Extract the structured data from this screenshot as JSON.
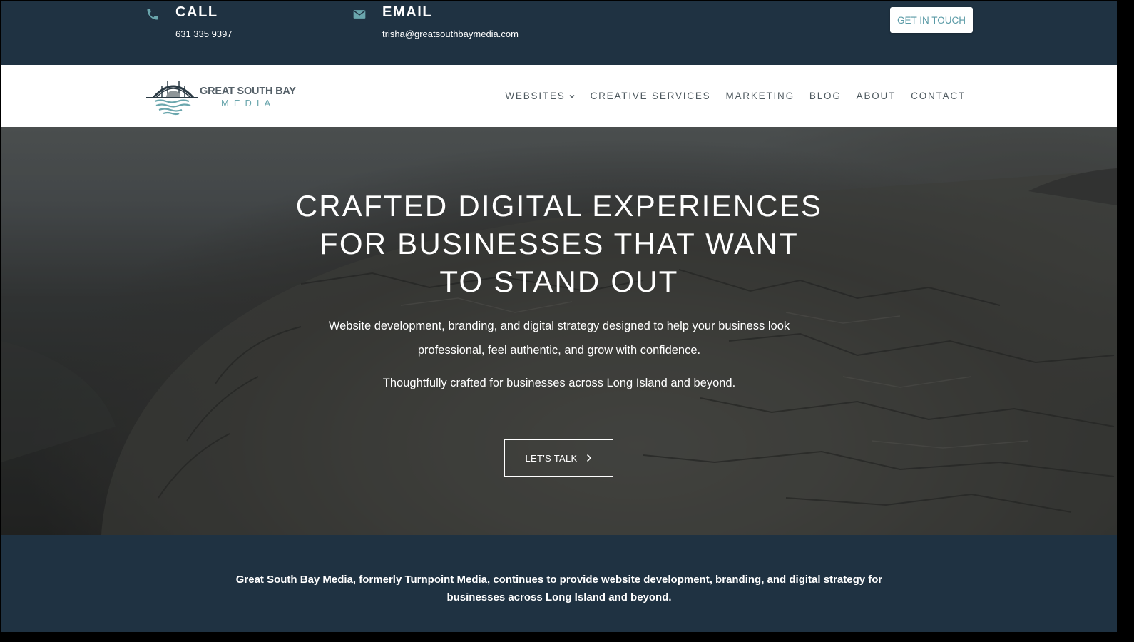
{
  "topbar": {
    "call": {
      "icon": "phone-icon",
      "title": "CALL",
      "value": "631 335 9397"
    },
    "email": {
      "icon": "envelope-icon",
      "title": "EMAIL",
      "value": "trisha@greatsouthbaymedia.com"
    },
    "cta_label": "GET IN TOUCH"
  },
  "logo": {
    "line1": "GREAT SOUTH BAY",
    "line2": "MEDIA"
  },
  "nav": {
    "items": [
      {
        "label": "WEBSITES",
        "has_dropdown": true
      },
      {
        "label": "CREATIVE SERVICES"
      },
      {
        "label": "MARKETING"
      },
      {
        "label": "BLOG"
      },
      {
        "label": "ABOUT"
      },
      {
        "label": "CONTACT"
      }
    ]
  },
  "hero": {
    "title_lines": [
      "CRAFTED DIGITAL EXPERIENCES",
      "FOR BUSINESSES THAT WANT",
      "TO STAND OUT"
    ],
    "subtitle": "Website development, branding, and digital strategy designed to help your business look professional, feel authentic, and grow with confidence.",
    "subtitle2": "Thoughtfully crafted for businesses across Long Island and beyond.",
    "cta_label": "LET'S TALK",
    "cta_icon": "chevron-right-icon"
  },
  "footer": {
    "text": "Great South Bay Media, formerly Turnpoint Media, continues to provide website development, branding, and digital strategy for businesses across Long Island and beyond."
  },
  "colors": {
    "navy": "#1f3242",
    "teal": "#5a9aa6",
    "nav_text": "#4f5a60",
    "white": "#ffffff"
  }
}
